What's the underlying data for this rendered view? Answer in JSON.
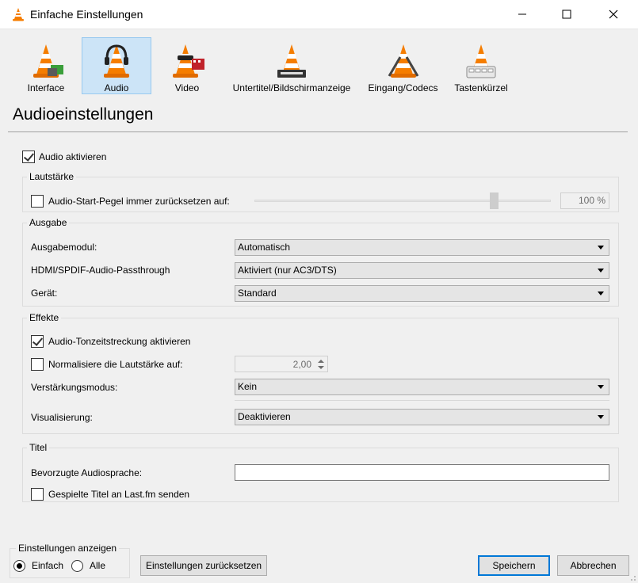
{
  "window": {
    "title": "Einfache Einstellungen",
    "icon": "vlc-cone-icon"
  },
  "toolbar": {
    "items": [
      {
        "label": "Interface",
        "icon": "interface-cone-icon",
        "selected": false
      },
      {
        "label": "Audio",
        "icon": "audio-cone-icon",
        "selected": true
      },
      {
        "label": "Video",
        "icon": "video-cone-icon",
        "selected": false
      },
      {
        "label": "Untertitel/Bildschirmanzeige",
        "icon": "subtitles-cone-icon",
        "selected": false
      },
      {
        "label": "Eingang/Codecs",
        "icon": "codecs-cone-icon",
        "selected": false
      },
      {
        "label": "Tastenkürzel",
        "icon": "hotkeys-cone-icon",
        "selected": false
      }
    ]
  },
  "page": {
    "heading": "Audioeinstellungen",
    "enable_audio": {
      "label": "Audio aktivieren",
      "checked": true
    }
  },
  "volume": {
    "title": "Lautstärke",
    "reset_label": "Audio-Start-Pegel immer zurücksetzen auf:",
    "reset_checked": false,
    "level": 100,
    "level_text": "100 %"
  },
  "output": {
    "title": "Ausgabe",
    "module_label": "Ausgabemodul:",
    "module_value": "Automatisch",
    "passthrough_label": "HDMI/SPDIF-Audio-Passthrough",
    "passthrough_value": "Aktiviert (nur AC3/DTS)",
    "device_label": "Gerät:",
    "device_value": "Standard"
  },
  "effects": {
    "title": "Effekte",
    "timestretch_label": "Audio-Tonzeitstreckung aktivieren",
    "timestretch_checked": true,
    "normalize_label": "Normalisiere die Lautstärke auf:",
    "normalize_checked": false,
    "normalize_value": "2,00",
    "gain_label": "Verstärkungsmodus:",
    "gain_value": "Kein",
    "visual_label": "Visualisierung:",
    "visual_value": "Deaktivieren"
  },
  "tracks": {
    "title": "Titel",
    "language_label": "Bevorzugte Audiosprache:",
    "language_value": "",
    "lastfm_label": "Gespielte Titel an Last.fm senden",
    "lastfm_checked": false
  },
  "footer": {
    "show_settings_title": "Einstellungen anzeigen",
    "simple_label": "Einfach",
    "simple_selected": true,
    "all_label": "Alle",
    "all_selected": false,
    "reset_button": "Einstellungen zurücksetzen",
    "save_button": "Speichern",
    "cancel_button": "Abbrechen"
  },
  "colors": {
    "cone_orange": "#f57d00",
    "selection_bg": "#cce4f7",
    "default_button_border": "#0078d7"
  }
}
